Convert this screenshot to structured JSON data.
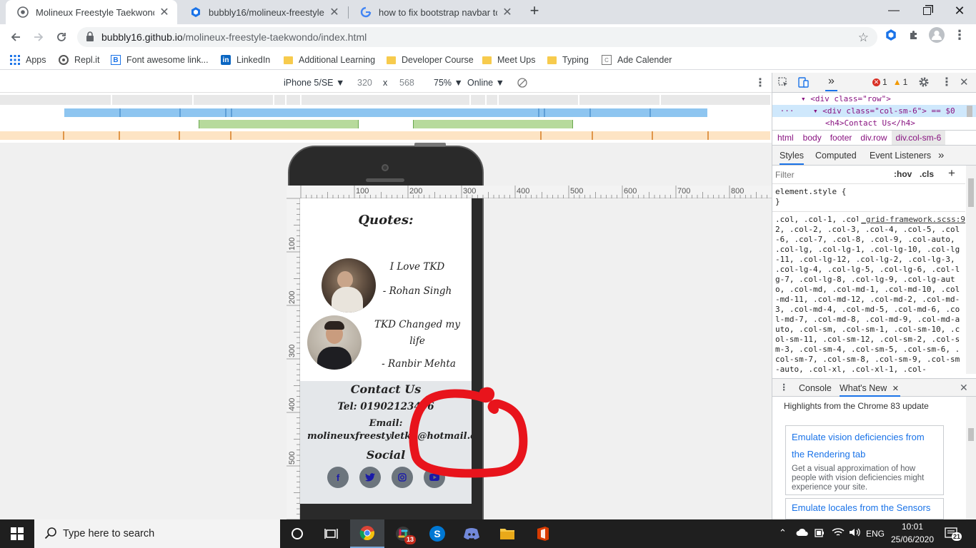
{
  "tabs": [
    {
      "title": "Molineux Freestyle Taekwondo",
      "active": true
    },
    {
      "title": "bubbly16/molineux-freestyle-tae",
      "active": false
    },
    {
      "title": "how to fix bootstrap navbar to to",
      "active": false
    }
  ],
  "new_tab_label": "+",
  "address": {
    "host": "bubbly16.github.io",
    "path": "/molineux-freestyle-taekwondo/index.html"
  },
  "bookmarks": [
    {
      "label": "Apps",
      "icon": "apps-grid-icon"
    },
    {
      "label": "Repl.it",
      "icon": "replit-icon"
    },
    {
      "label": "Font awesome link...",
      "icon": "bootstrap-b-icon"
    },
    {
      "label": "LinkedIn",
      "icon": "linkedin-icon"
    },
    {
      "label": "Additional Learning",
      "icon": "folder-icon"
    },
    {
      "label": "Developer Course",
      "icon": "folder-icon"
    },
    {
      "label": "Meet Ups",
      "icon": "folder-icon"
    },
    {
      "label": "Typing",
      "icon": "folder-icon"
    },
    {
      "label": "Ade Calender",
      "icon": "calendar-icon"
    }
  ],
  "device_toolbar": {
    "device": "iPhone 5/SE ▼",
    "width": "320",
    "times": "x",
    "height": "568",
    "zoom": "75% ▼",
    "network": "Online ▼"
  },
  "ruler": {
    "h_labels": [
      "100",
      "200",
      "300",
      "400",
      "500",
      "600",
      "700",
      "800"
    ],
    "v_labels": [
      "100",
      "200",
      "300",
      "400",
      "500"
    ]
  },
  "page": {
    "quotes_title": "Quotes:",
    "quote1_text": "I Love TKD",
    "quote1_author": "- Rohan Singh",
    "quote2_text": "TKD Changed my life",
    "quote2_author": "- Ranbir Mehta",
    "contact_title": "Contact Us",
    "tel": "Tel: 01902123456",
    "email_label": "Email:",
    "email": "molineuxfreestyletkd@hotmail.com",
    "social_title": "Social",
    "social_icons": [
      "f",
      "t",
      "ig",
      "yt"
    ]
  },
  "devtools": {
    "errors": "1",
    "warnings": "1",
    "dom_lines": [
      "<div class=\"row\">",
      "<div class=\"col-sm-6\"> == $0",
      "<h4>Contact Us</h4>"
    ],
    "breadcrumbs": [
      "html",
      "body",
      "footer",
      "div.row",
      "div.col-sm-6"
    ],
    "style_tabs": [
      "Styles",
      "Computed",
      "Event Listeners",
      "»"
    ],
    "filter_placeholder": "Filter",
    "hov": ":hov",
    "cls": ".cls",
    "element_style": "element.style {",
    "element_style_close": "}",
    "rule_source": "_grid-framework.scss:9",
    "selector_text": ".col, .col-1, .col-10, .col-11, .col-12, .col-2, .col-3, .col-4, .col-5, .col-6, .col-7, .col-8, .col-9, .col-auto, .col-lg, .col-lg-1, .col-lg-10, .col-lg-11, .col-lg-12, .col-lg-2, .col-lg-3, .col-lg-4, .col-lg-5, .col-lg-6, .col-lg-7, .col-lg-8, .col-lg-9, .col-lg-auto, .col-md, .col-md-1, .col-md-10, .col-md-11, .col-md-12, .col-md-2, .col-md-3, .col-md-4, .col-md-5, .col-md-6, .col-md-7, .col-md-8, .col-md-9, .col-md-auto, .col-sm, .col-sm-1, .col-sm-10, .col-sm-11, .col-sm-12, .col-sm-2, .col-sm-3, .col-sm-4, .col-sm-5, .col-sm-6, .col-sm-7, .col-sm-8, .col-sm-9, .col-sm-auto, .col-xl, .col-xl-1, .col-",
    "drawer_tabs": [
      "Console",
      "What's New"
    ],
    "drawer_heading": "Highlights from the Chrome 83 update",
    "card1_title": "Emulate vision deficiencies from the Rendering tab",
    "card1_desc": "Get a visual approximation of how people with vision deficiencies might experience your site.",
    "card2_title": "Emulate locales from the Sensors"
  },
  "taskbar": {
    "search_placeholder": "Type here to search",
    "badge": "13",
    "lang": "ENG",
    "time": "10:01",
    "date": "25/06/2020",
    "notif_count": "21"
  },
  "colors": {
    "annotation_red": "#e8141c",
    "mq_blue": "#8ec5f0",
    "mq_green": "#b7da9c",
    "mq_orange": "#fde4c4",
    "link_blue": "#1a73e8"
  }
}
